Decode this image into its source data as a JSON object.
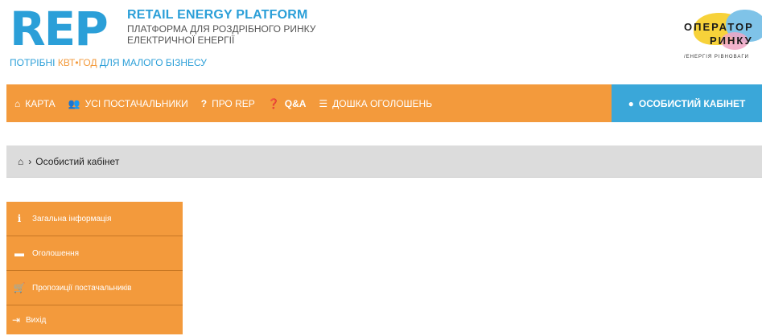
{
  "header": {
    "logo_text": "REP",
    "platform_title": "RETAIL ENERGY PLATFORM",
    "platform_sub1": "ПЛАТФОРМА ДЛЯ РОЗДРІБНОГО РИНКУ",
    "platform_sub2": "ЕЛЕКТРИЧНОЇ ЕНЕРГІЇ",
    "tagline_pre": "ПОТРІБНІ ",
    "tagline_hl": "КВТ•ГОД",
    "tagline_post": " ДЛЯ МАЛОГО БІЗНЕСУ",
    "operator_line1": "ОПЕРАТОР",
    "operator_line2": "РИНКУ",
    "operator_tag": "/ЕНЕРГІЯ РІВНОВАГИ"
  },
  "nav": {
    "items": [
      {
        "label": "КАРТА",
        "icon": "home-icon"
      },
      {
        "label": "УСІ ПОСТАЧАЛЬНИКИ",
        "icon": "users-icon"
      },
      {
        "label": "ПРО REP",
        "icon": "question-icon"
      },
      {
        "label": "Q&A",
        "icon": "help-circle-icon"
      },
      {
        "label": "ДОШКА ОГОЛОШЕНЬ",
        "icon": "list-icon"
      }
    ],
    "cabinet_label": "ОСОБИСТИЙ КАБІНЕТ"
  },
  "breadcrumb": {
    "separator": "›",
    "current": "Особистий кабінет"
  },
  "sidebar": {
    "items": [
      {
        "label": "Загальна інформація",
        "icon": "info-icon"
      },
      {
        "label": "Оголошення",
        "icon": "briefcase-icon"
      },
      {
        "label": "Пропозиції постачальників",
        "icon": "cart-icon"
      },
      {
        "label": "Вихід",
        "icon": "logout-icon"
      }
    ]
  },
  "colors": {
    "brand_blue": "#2b9fd8",
    "brand_orange": "#f39a3c",
    "cabinet_blue": "#3aa7d9",
    "breadcrumb_bg": "#dcdcdc"
  }
}
